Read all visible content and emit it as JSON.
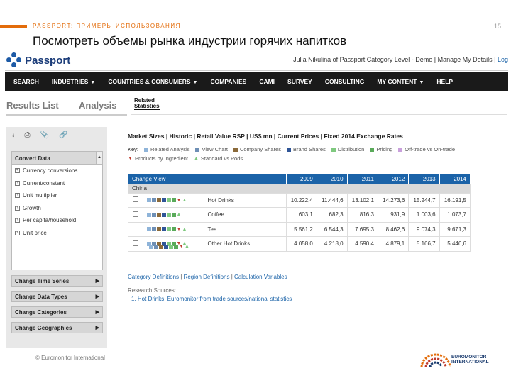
{
  "slide": {
    "supertitle": "PASSPORT: ПРИМЕРЫ ИСПОЛЬЗОВАНИЯ",
    "title": "Посмотреть объемы рынка индустрии горячих напитков",
    "page_number": "15",
    "footer": "© Euromonitor International",
    "logo_line1": "EUROMONITOR",
    "logo_line2": "INTERNATIONAL",
    "accent_color": "#e36c0a"
  },
  "app": {
    "brand": "Passport",
    "user_text": "Julia Nikulina of Passport Category Level - Demo",
    "manage_label": "Manage My Details",
    "log_label": "Log",
    "nav": [
      {
        "label": "SEARCH",
        "caret": false
      },
      {
        "label": "INDUSTRIES",
        "caret": true
      },
      {
        "label": "COUNTRIES & CONSUMERS",
        "caret": true
      },
      {
        "label": "COMPANIES",
        "caret": false
      },
      {
        "label": "CAMI",
        "caret": false
      },
      {
        "label": "SURVEY",
        "caret": false
      },
      {
        "label": "CONSULTING",
        "caret": false
      },
      {
        "label": "MY CONTENT",
        "caret": true
      },
      {
        "label": "HELP",
        "caret": false
      }
    ],
    "tabs": {
      "results": "Results List",
      "analysis": "Analysis",
      "related_line1": "Related",
      "related_line2": "Statistics"
    },
    "toolbar_icons": [
      "download-icon",
      "print-icon",
      "attach-icon",
      "link-icon"
    ],
    "convert": {
      "heading": "Convert Data",
      "items": [
        "Currency conversions",
        "Current/constant",
        "Unit multiplier",
        "Growth",
        "Per capita/household",
        "Unit price"
      ]
    },
    "side_buttons": [
      "Change Time Series",
      "Change Data Types",
      "Change Categories",
      "Change Geographies"
    ],
    "crumb": [
      "Market Sizes",
      "Historic",
      "Retail Value RSP",
      "US$ mn",
      "Current Prices",
      "Fixed 2014 Exchange Rates"
    ],
    "key": {
      "label": "Key:",
      "items": [
        {
          "label": "Related Analysis",
          "color": "#8fb4d9"
        },
        {
          "label": "View Chart",
          "color": "#6e8fb5"
        },
        {
          "label": "Company Shares",
          "color": "#8b6a3a"
        },
        {
          "label": "Brand Shares",
          "color": "#2f5597"
        },
        {
          "label": "Distribution",
          "color": "#7fc97f"
        },
        {
          "label": "Pricing",
          "color": "#5aaa5a"
        },
        {
          "label": "Off-trade vs On-trade",
          "color": "#c9a0dc"
        },
        {
          "label": "Products by Ingredient",
          "color": "#c0392b"
        },
        {
          "label": "Standard vs Pods",
          "color": "#7fc97f"
        }
      ]
    },
    "table": {
      "header_label": "Change View",
      "years": [
        "2009",
        "2010",
        "2011",
        "2012",
        "2013",
        "2014"
      ],
      "country": "China",
      "rows": [
        {
          "name": "Hot Drinks",
          "values": [
            "10.222,4",
            "11.444,6",
            "13.102,1",
            "14.273,6",
            "15.244,7",
            "16.191,5"
          ]
        },
        {
          "name": "Coffee",
          "values": [
            "603,1",
            "682,3",
            "816,3",
            "931,9",
            "1.003,6",
            "1.073,7"
          ]
        },
        {
          "name": "Tea",
          "values": [
            "5.561,2",
            "6.544,3",
            "7.695,3",
            "8.462,6",
            "9.074,3",
            "9.671,3"
          ]
        },
        {
          "name": "Other Hot Drinks",
          "values": [
            "4.058,0",
            "4.218,0",
            "4.590,4",
            "4.879,1",
            "5.166,7",
            "5.446,6"
          ]
        }
      ]
    },
    "links": [
      "Category Definitions",
      "Region Definitions",
      "Calculation Variables"
    ],
    "research_label": "Research Sources:",
    "research_item": "1.  Hot Drinks: Euromonitor from trade sources/national statistics"
  }
}
